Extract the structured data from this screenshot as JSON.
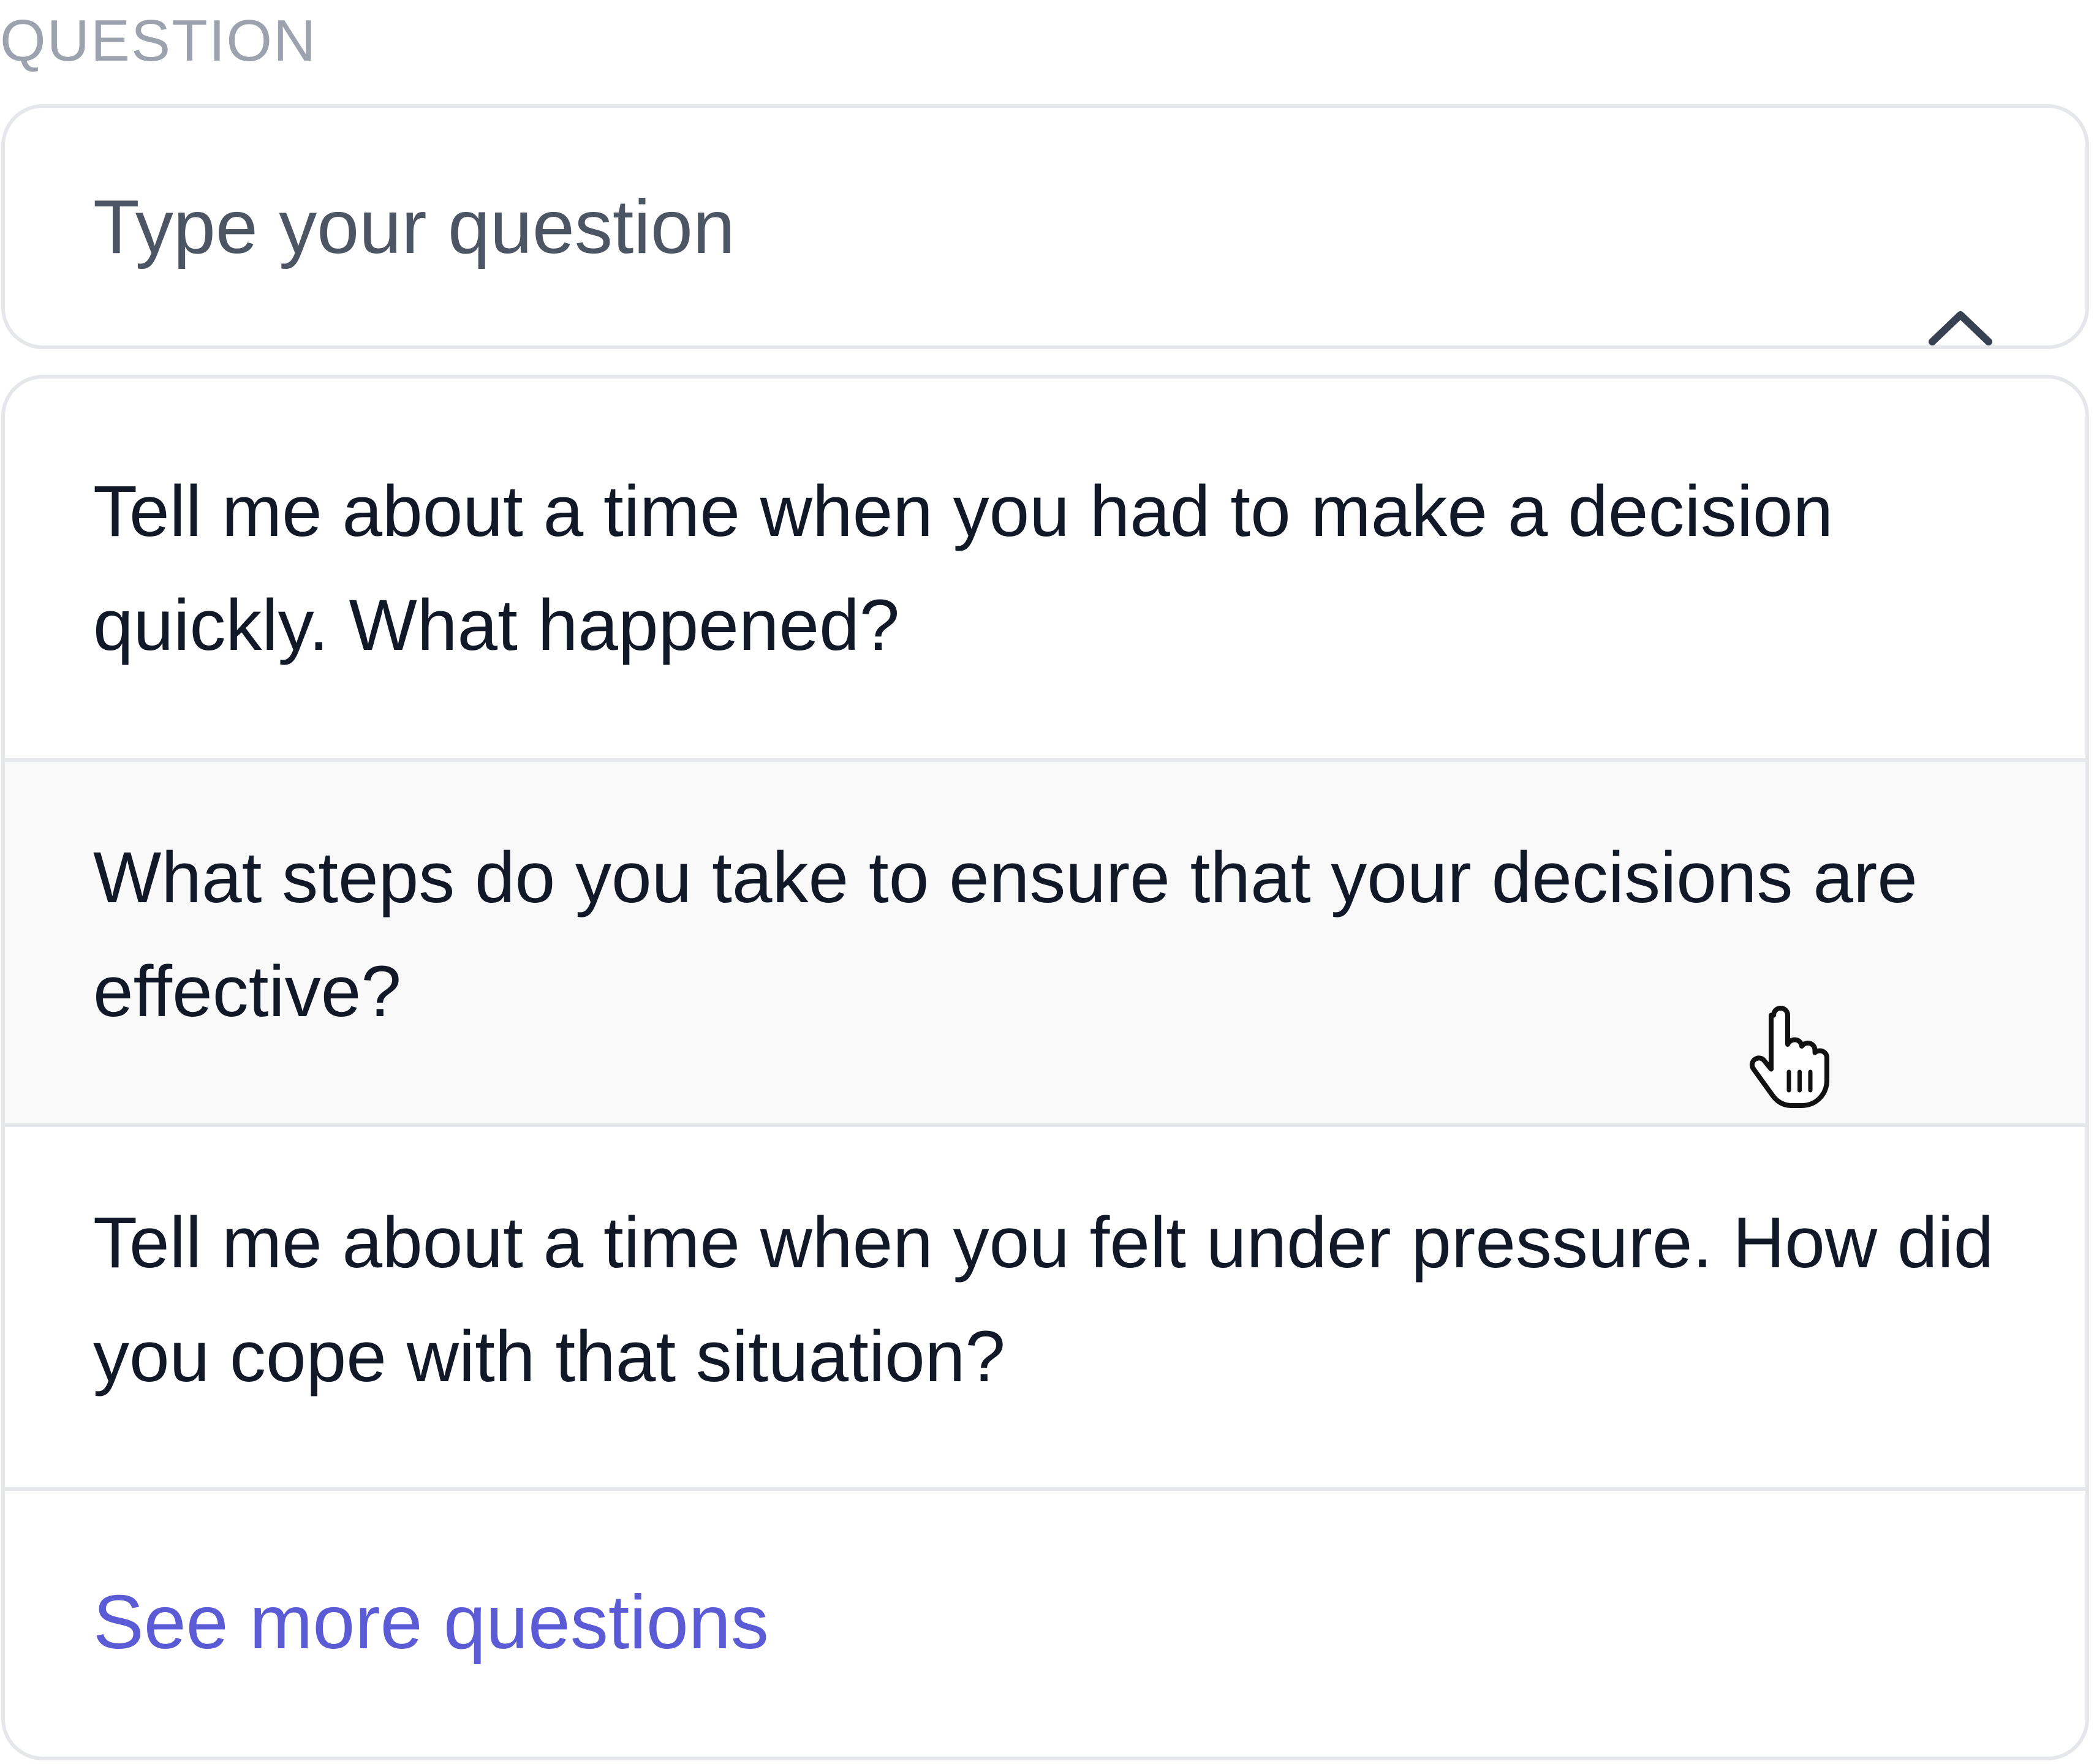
{
  "section": {
    "label": "QUESTION"
  },
  "question_input": {
    "placeholder": "Type your question",
    "value": "",
    "toggle_icon": "chevron-up-icon"
  },
  "dropdown": {
    "options": [
      {
        "label": "Tell me about a time when you had to make a decision quickly. What happened?"
      },
      {
        "label": "What steps do you take to ensure that your decisions are effective?",
        "hovered": true
      },
      {
        "label": "Tell me about a time when you felt under pressure. How did you cope with that situation?"
      }
    ],
    "see_more_label": "See more questions"
  },
  "pointer": {
    "icon": "hand-pointer-icon"
  },
  "colors": {
    "label_gray": "#9ca3af",
    "placeholder_gray": "#4b5563",
    "text_dark": "#111827",
    "border": "#e5e7eb",
    "hover_bg": "#f9f9f9",
    "link_accent": "#5b5bd6"
  }
}
